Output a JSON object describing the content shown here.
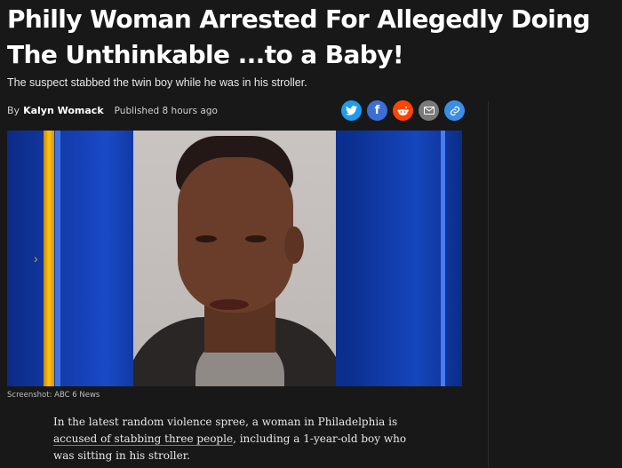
{
  "article": {
    "headline": "Philly Woman Arrested For Allegedly Doing The Unthinkable ...to a Baby!",
    "subtitle": "The suspect stabbed the twin boy while he was in his stroller.",
    "byline_prefix": "By",
    "author": "Kalyn Womack",
    "published": "Published 8 hours ago",
    "image_caption": "Screenshot: ABC 6 News",
    "body": {
      "before_link": "In the latest random violence spree, a woman in Philadelphia is ",
      "link_text": "accused of stabbing three people",
      "after_link": ", including a 1-year-old boy who was sitting in his stroller."
    }
  },
  "share": [
    {
      "name": "twitter",
      "icon": "twitter-bird-icon",
      "color": "#1d9bf0",
      "glyph": "🐦"
    },
    {
      "name": "facebook",
      "icon": "facebook-f-icon",
      "color": "#3b6fd8",
      "glyph": "f"
    },
    {
      "name": "reddit",
      "icon": "reddit-alien-icon",
      "color": "#ff4500",
      "glyph": "●"
    },
    {
      "name": "email",
      "icon": "envelope-icon",
      "color": "#7a7a7a",
      "glyph": "✉"
    },
    {
      "name": "link",
      "icon": "link-icon",
      "color": "#3a8ee6",
      "glyph": "🔗"
    }
  ],
  "colors": {
    "background": "#181818",
    "link_underline": "#3ea35a"
  }
}
